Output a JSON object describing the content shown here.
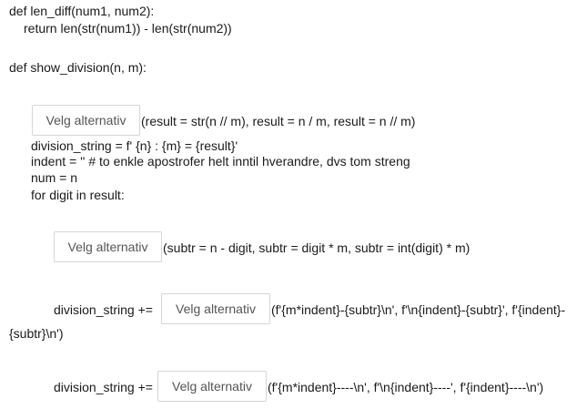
{
  "code": {
    "line1": "def len_diff(num1, num2):",
    "line2": "return len(str(num1)) - len(str(num2))",
    "line3": "def show_division(n, m):",
    "q1_options": "(result = str(n // m), result = n / m, result = n // m)",
    "line_division_string": "division_string = f' {n} : {m} = {result}'",
    "line_indent": "indent = ''   # to enkle apostrofer helt inntil hverandre, dvs tom streng",
    "line_num": "num = n",
    "line_for": "for digit in result:",
    "q2_options": "(subtr = n - digit, subtr = digit * m, subtr = int(digit) * m)",
    "q3_prefix": "division_string +=",
    "q3_options_a": "(f'{m*indent}-{subtr}\\n', f'\\n{indent}-{subtr}', f'{indent}-",
    "q3_options_b": "{subtr}\\n')",
    "q4_prefix": "division_string +=",
    "q4_options": "(f'{m*indent}----\\n', f'\\n{indent}----', f'{indent}----\\n')"
  },
  "select": {
    "label": "Velg alternativ"
  }
}
